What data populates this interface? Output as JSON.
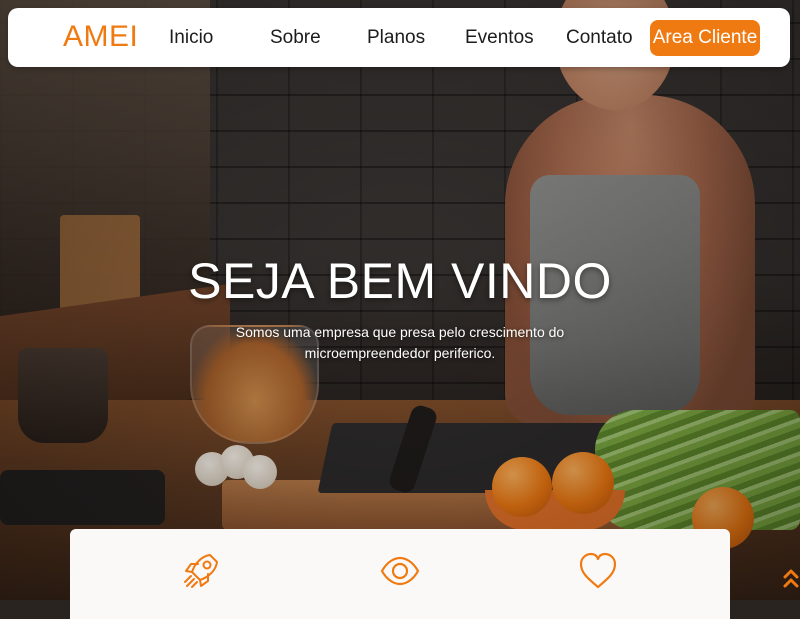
{
  "brand": {
    "name": "AMEI",
    "color": "#f07a12"
  },
  "nav": {
    "items": [
      {
        "label": "Inicio"
      },
      {
        "label": "Sobre"
      },
      {
        "label": "Planos"
      },
      {
        "label": "Eventos"
      },
      {
        "label": "Contato"
      }
    ],
    "cta_label": "Area Cliente"
  },
  "hero": {
    "title": "SEJA BEM VINDO",
    "subtitle_line1": "Somos uma empresa que presa pelo crescimento do",
    "subtitle_line2": "microempreendedor periferico.",
    "background": "kitchen-cooking-photo"
  },
  "features": {
    "icons": [
      "rocket-icon",
      "eye-icon",
      "heart-icon"
    ]
  },
  "scroll_top": {
    "icon": "double-chevron-up-icon"
  },
  "colors": {
    "accent": "#f07a12",
    "nav_bg": "#ffffff",
    "text_dark": "#1c1c1c",
    "card_bg": "#fbf9f7"
  }
}
